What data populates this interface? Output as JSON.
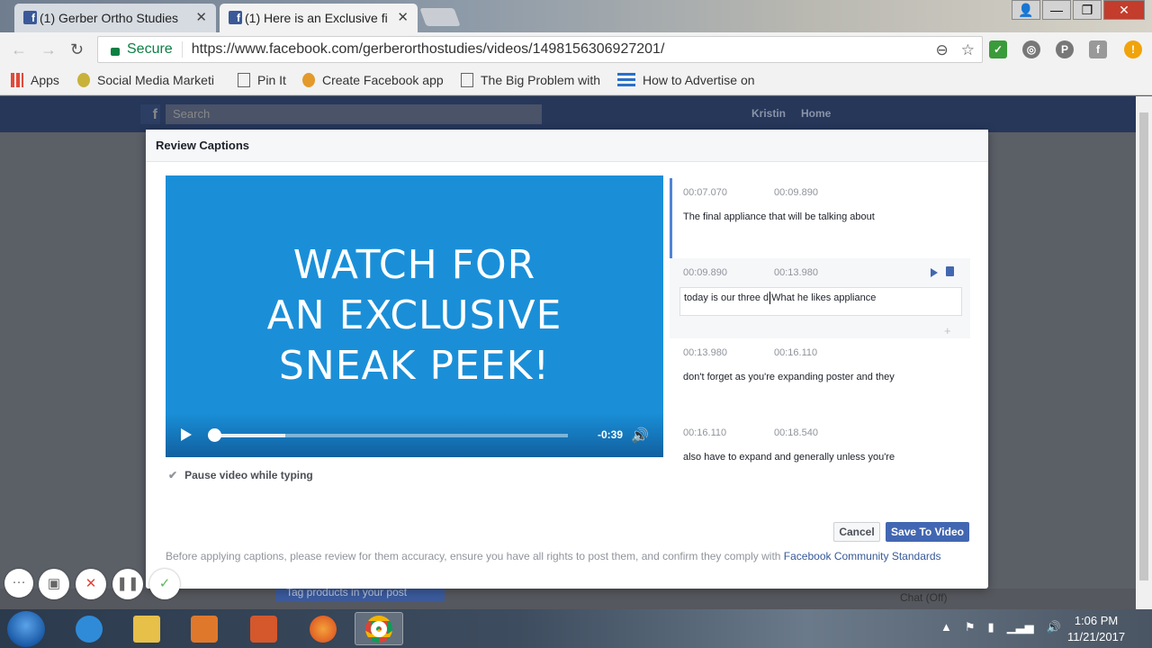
{
  "browser": {
    "tabs": [
      {
        "title": "(1) Gerber Ortho Studies",
        "active": false
      },
      {
        "title": "(1) Here is an Exclusive fi",
        "active": true
      }
    ],
    "window_buttons": {
      "minimize": "—",
      "restore": "❐",
      "close": "✕"
    },
    "secure_label": "Secure",
    "url": "https://www.facebook.com/gerberorthostudies/videos/1498156306927201/",
    "bookmarks": [
      {
        "label": "Apps"
      },
      {
        "label": "Social Media Marketi"
      },
      {
        "label": "Pin It"
      },
      {
        "label": "Create Facebook app"
      },
      {
        "label": "The Big Problem with"
      },
      {
        "label": "How to Advertise on"
      }
    ]
  },
  "facebook": {
    "search_placeholder": "Search",
    "user_name": "Kristin",
    "home_label": "Home",
    "notification_count": "1",
    "tag_products": "Tag products in your post",
    "chat_status": "Chat (Off)"
  },
  "modal": {
    "title": "Review Captions",
    "video": {
      "line1": "WATCH FOR",
      "line2": "AN EXCLUSIVE",
      "line3": "SNEAK PEEK!",
      "time_remaining": "-0:39",
      "progress": 0.0,
      "buffered": 0.21
    },
    "pause_label": "Pause video while typing",
    "captions": [
      {
        "start": "00:07.070",
        "end": "00:09.890",
        "text": "The final appliance that will be talking about"
      },
      {
        "start": "00:09.890",
        "end": "00:13.980",
        "text_before": "today is our three d",
        "text_after": "What he likes appliance",
        "editing": true
      },
      {
        "start": "00:13.980",
        "end": "00:16.110",
        "text": "don't forget as you're expanding poster and they"
      },
      {
        "start": "00:16.110",
        "end": "00:18.540",
        "text": "also have to expand and generally unless you're"
      }
    ],
    "cancel_label": "Cancel",
    "save_label": "Save To Video",
    "footnote": "Before applying captions, please review for them accuracy, ensure you have all rights to post them, and confirm they comply with ",
    "footnote_link": "Facebook Community Standards"
  },
  "taskbar": {
    "time": "1:06 PM",
    "date": "11/21/2017"
  },
  "colors": {
    "facebook_blue": "#4267b2",
    "video_blue": "#1a8fd8",
    "secure_green": "#0b8043"
  }
}
